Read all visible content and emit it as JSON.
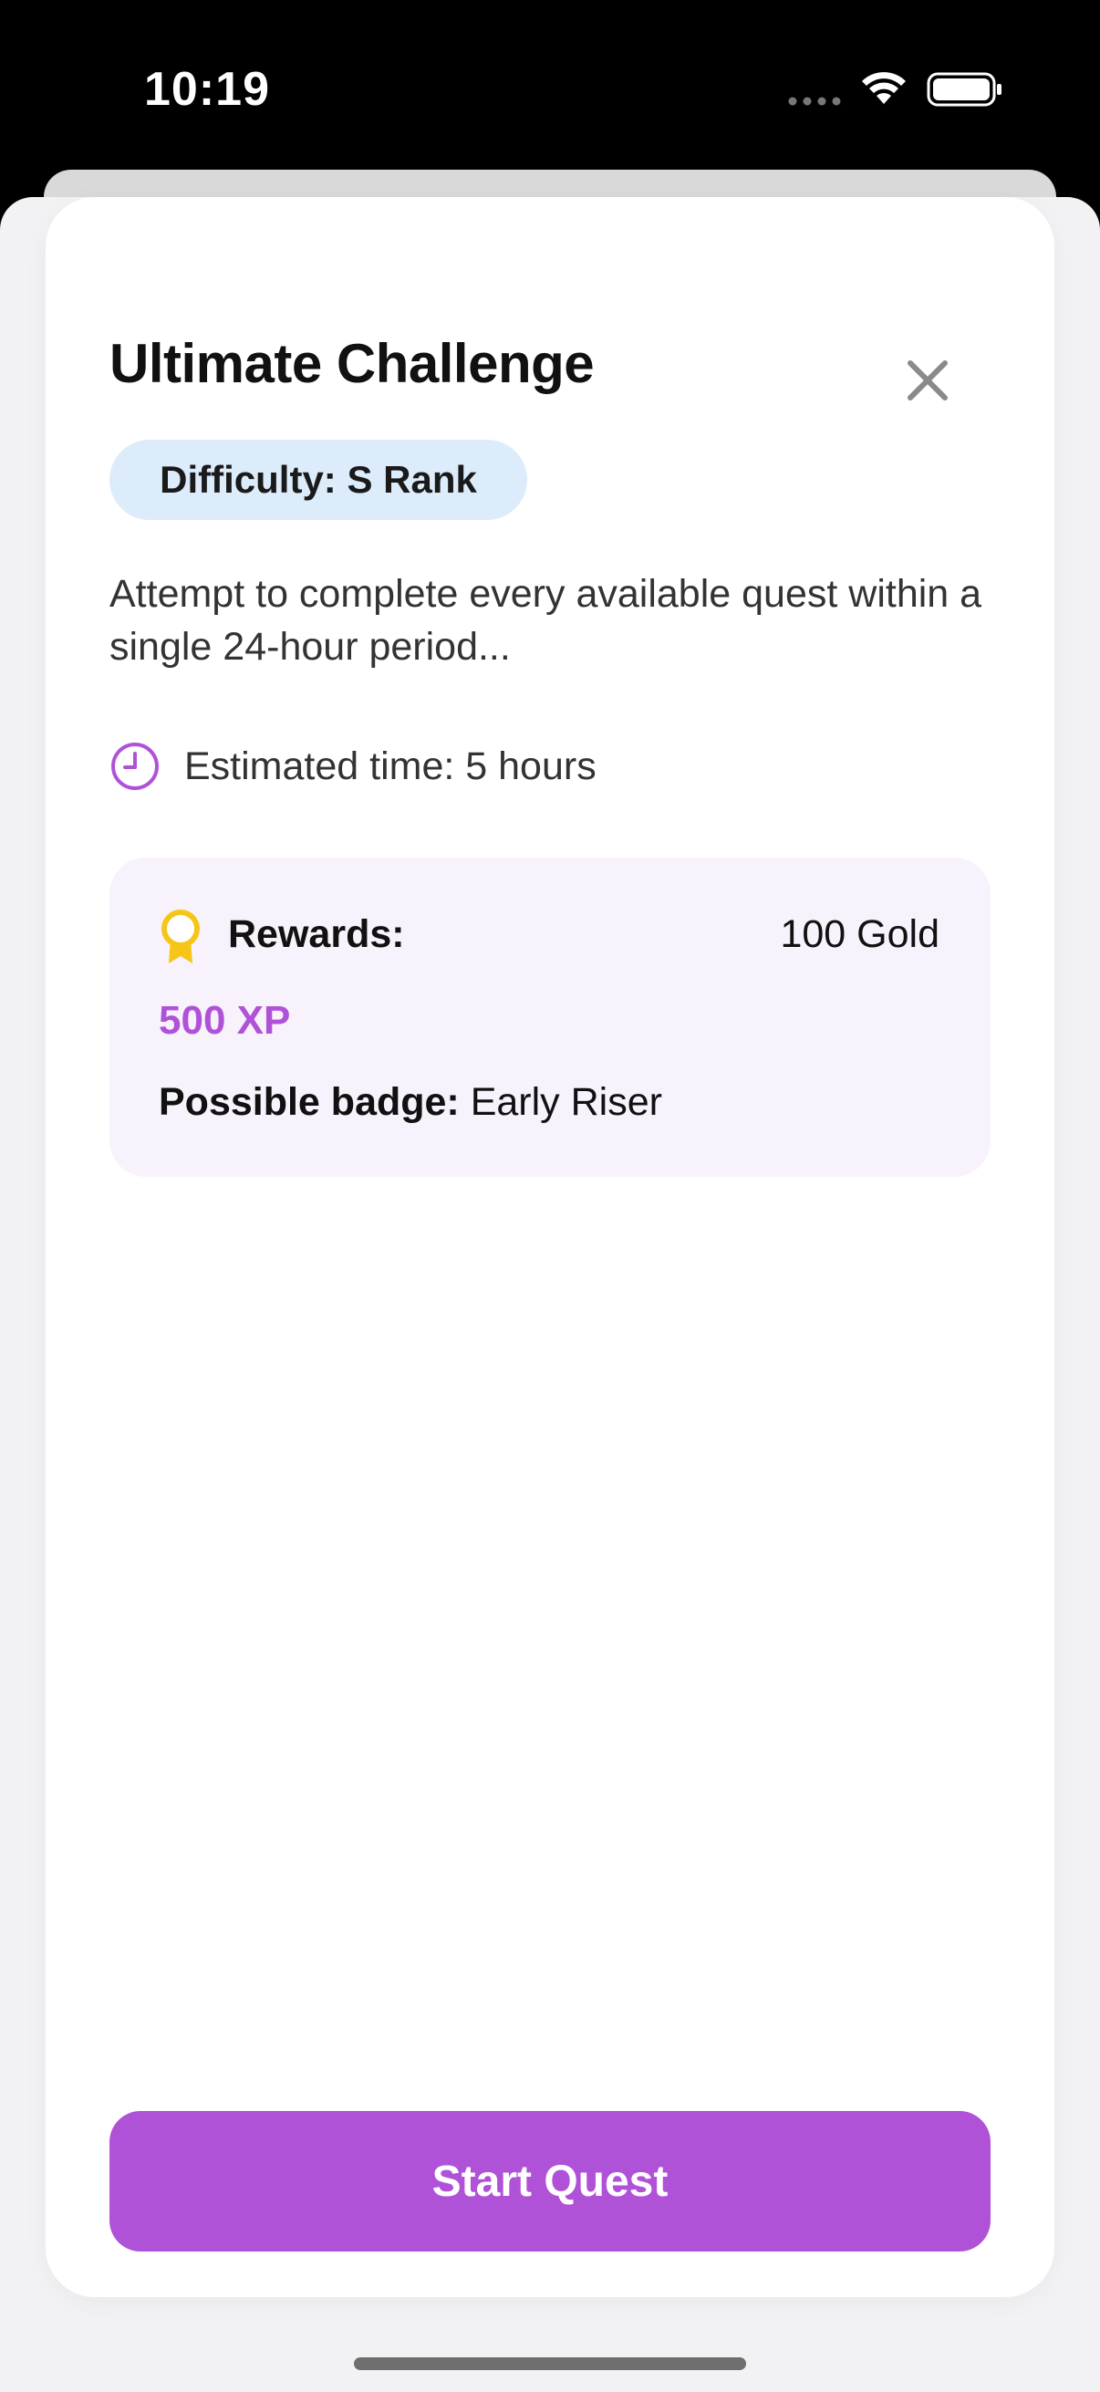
{
  "status_bar": {
    "time": "10:19"
  },
  "sheet": {
    "title": "Ultimate Challenge",
    "difficulty": "Difficulty: S Rank",
    "description": "Attempt to complete every available quest within a single 24-hour period...",
    "estimated_time": "Estimated time: 5 hours",
    "rewards": {
      "label": "Rewards:",
      "gold": "100 Gold",
      "xp": "500 XP",
      "badge_label": "Possible badge:",
      "badge_value": "Early Riser"
    },
    "start_button": "Start Quest"
  },
  "colors": {
    "accent": "#b052d8",
    "badge_bg": "#dcecfb",
    "rewards_bg": "#f7f2fb",
    "reward_icon": "#f5c518"
  },
  "icons": {
    "close": "close-icon",
    "clock": "clock-icon",
    "reward": "award-ribbon-icon",
    "wifi": "wifi-icon",
    "battery": "battery-icon"
  }
}
